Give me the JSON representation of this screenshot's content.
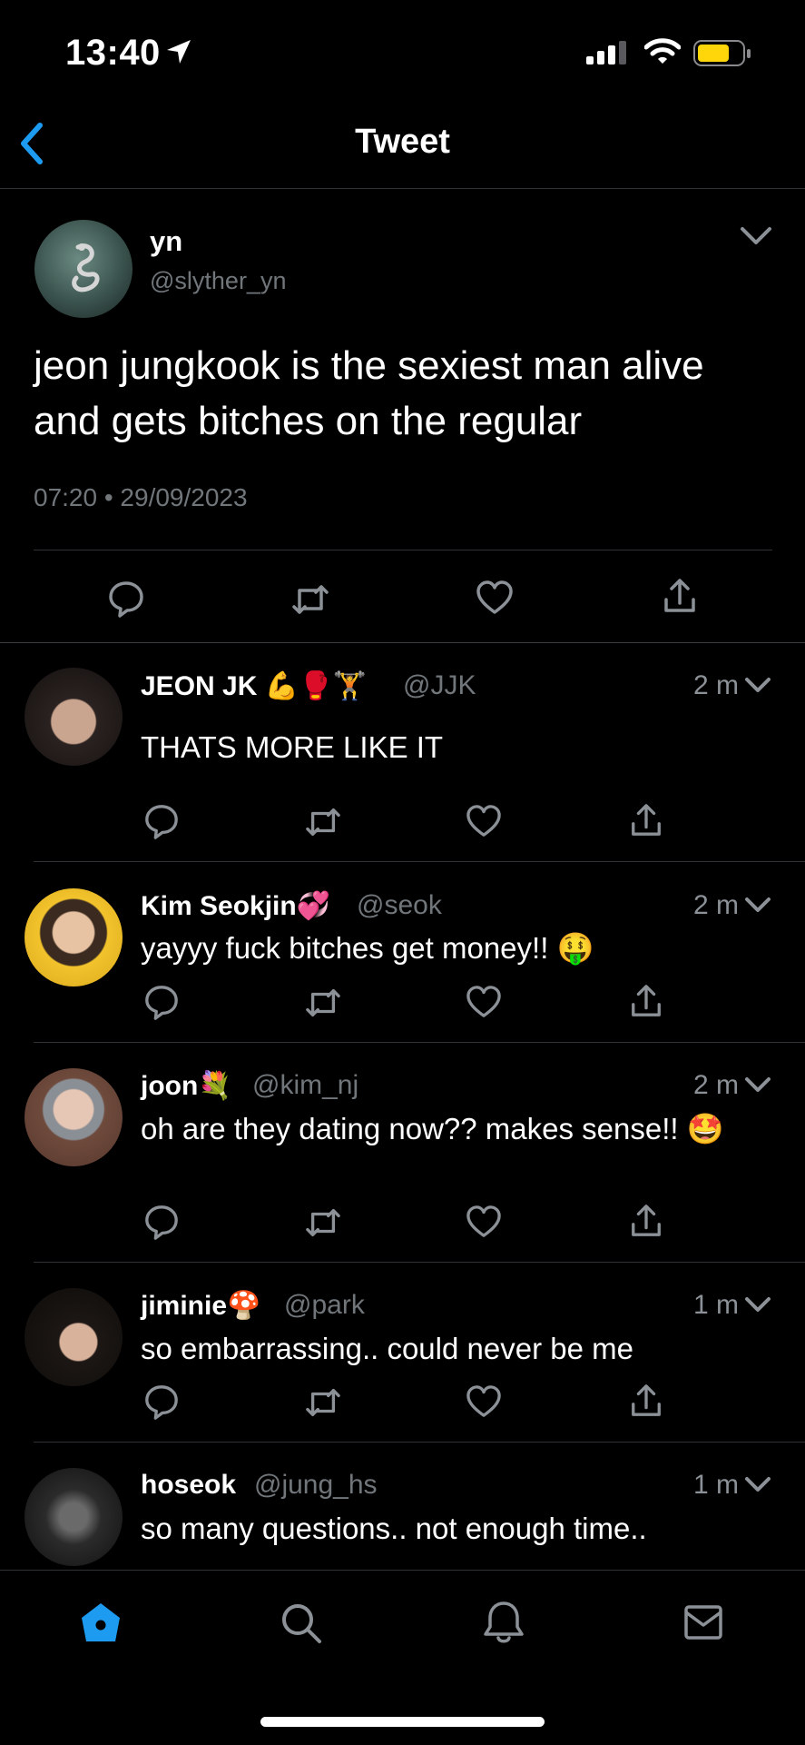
{
  "status_bar": {
    "time": "13:40"
  },
  "nav": {
    "title": "Tweet"
  },
  "tweet": {
    "name": "yn",
    "handle": "@slyther_yn",
    "text": "jeon jungkook is the sexiest man alive and gets bitches on the regular",
    "meta": "07:20 • 29/09/2023"
  },
  "replies": [
    {
      "name": "JEON JK",
      "emoji": "💪🥊🏋",
      "handle": "@JJK",
      "time": "2 m",
      "text": "THATS MORE LIKE IT"
    },
    {
      "name": "Kim Seokjin",
      "emoji": "💞",
      "handle": "@seok",
      "time": "2 m",
      "text": "yayyy fuck bitches get money!! 🤑"
    },
    {
      "name": "joon",
      "emoji": "💐",
      "handle": "@kim_nj",
      "time": "2 m",
      "text": "oh are they dating now?? makes sense!! 🤩"
    },
    {
      "name": "jiminie",
      "emoji": "🍄",
      "handle": "@park",
      "time": "1 m",
      "text": "so embarrassing.. could never be me"
    },
    {
      "name": "hoseok",
      "emoji": "",
      "handle": "@jung_hs",
      "time": "1 m",
      "text": "so many questions.. not enough time.."
    }
  ],
  "icons": {
    "reply": "reply-icon",
    "retweet": "retweet-icon",
    "like": "heart-icon",
    "share": "share-icon",
    "home": "home-icon",
    "search": "search-icon",
    "notifications": "bell-icon",
    "messages": "mail-icon"
  },
  "colors": {
    "accent": "#1d9bf0",
    "battery": "#ffd60a",
    "muted": "#71767b"
  }
}
